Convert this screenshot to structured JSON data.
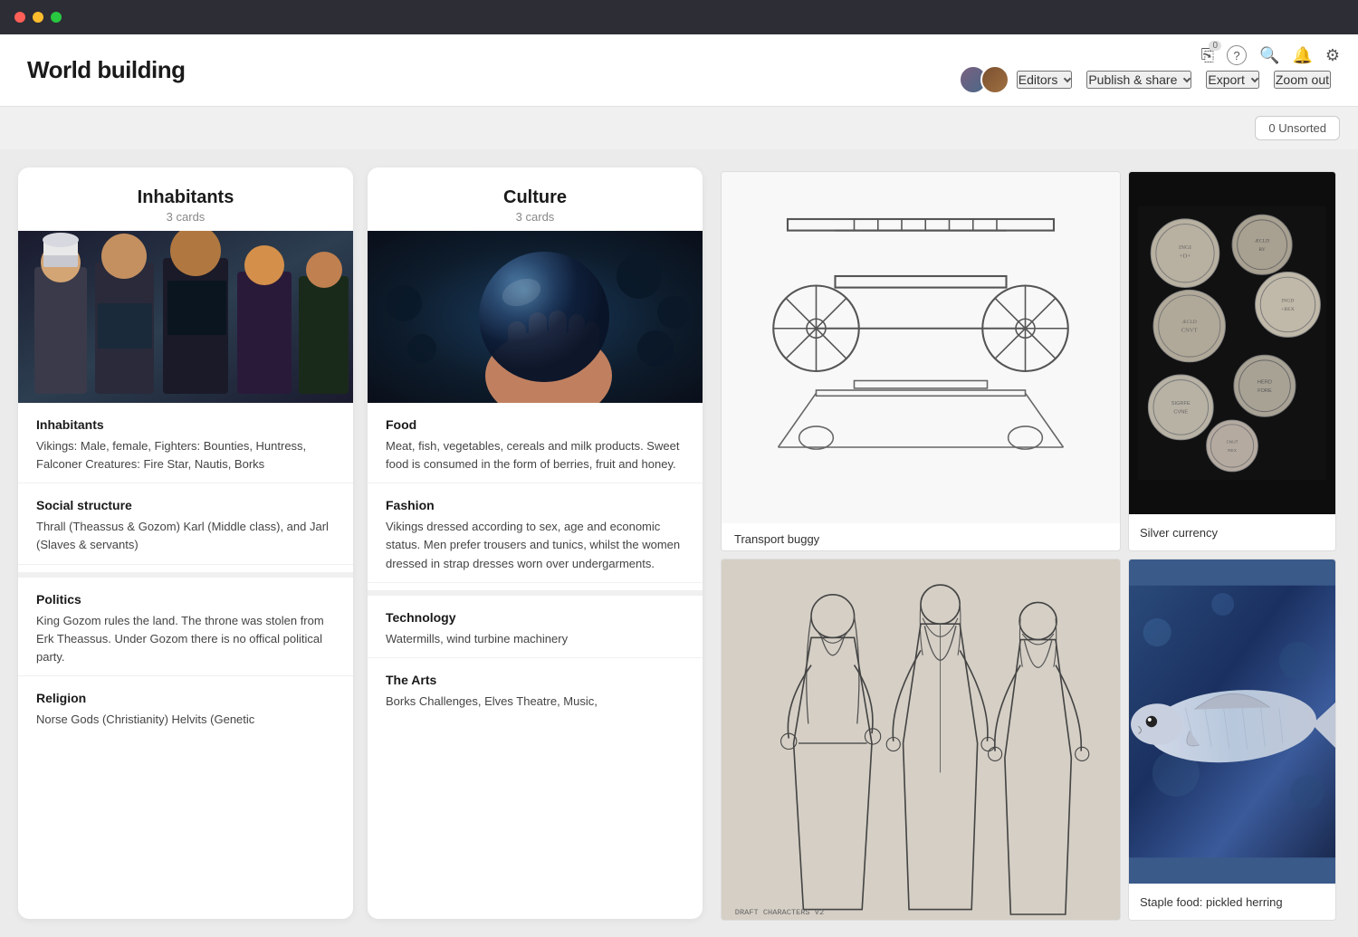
{
  "titlebar": {
    "dots": [
      "red",
      "yellow",
      "green"
    ]
  },
  "topbar": {
    "title": "World building",
    "icons": {
      "clipboard_badge": "0",
      "question": "?",
      "search": "🔍",
      "bell": "🔔",
      "gear": "⚙"
    },
    "editors_label": "Editors",
    "publish_label": "Publish & share",
    "export_label": "Export",
    "zoom_label": "Zoom out"
  },
  "toolbar": {
    "unsorted_label": "0 Unsorted"
  },
  "columns": [
    {
      "id": "inhabitants",
      "title": "Inhabitants",
      "count": "3 cards",
      "sections": [
        {
          "title": "Inhabitants",
          "text": "Vikings: Male, female, Fighters: Bounties, Huntress, Falconer Creatures: Fire Star, Nautis, Borks"
        },
        {
          "title": "Social structure",
          "text": "Thrall (Theassus & Gozom) Karl (Middle class), and Jarl (Slaves & servants)"
        },
        {
          "title": "Politics",
          "text": "King Gozom rules the land. The throne was stolen from Erk Theassus. Under Gozom there is no offical political party."
        },
        {
          "title": "Religion",
          "text": "Norse Gods (Christianity) Helvits (Genetic"
        }
      ]
    },
    {
      "id": "culture",
      "title": "Culture",
      "count": "3 cards",
      "sections": [
        {
          "title": "Food",
          "text": "Meat, fish, vegetables, cereals and milk products. Sweet food is consumed in the form of berries, fruit and honey."
        },
        {
          "title": "Fashion",
          "text": "Vikings dressed according to sex, age and economic status. Men prefer trousers and tunics, whilst the women dressed in strap dresses worn over undergarments."
        },
        {
          "title": "Technology",
          "text": "Watermills, wind turbine machinery"
        },
        {
          "title": "The Arts",
          "text": "Borks Challenges, Elves Theatre, Music,"
        }
      ]
    }
  ],
  "canvas_cards": [
    {
      "id": "transport-buggy",
      "label": "Transport buggy",
      "position": "topleft"
    },
    {
      "id": "silver-currency",
      "label": "Silver currency",
      "position": "topright"
    },
    {
      "id": "character-sketches",
      "label": "",
      "position": "bottomleft"
    },
    {
      "id": "staple-food",
      "label": "Staple food: pickled herring",
      "position": "bottomright"
    }
  ]
}
